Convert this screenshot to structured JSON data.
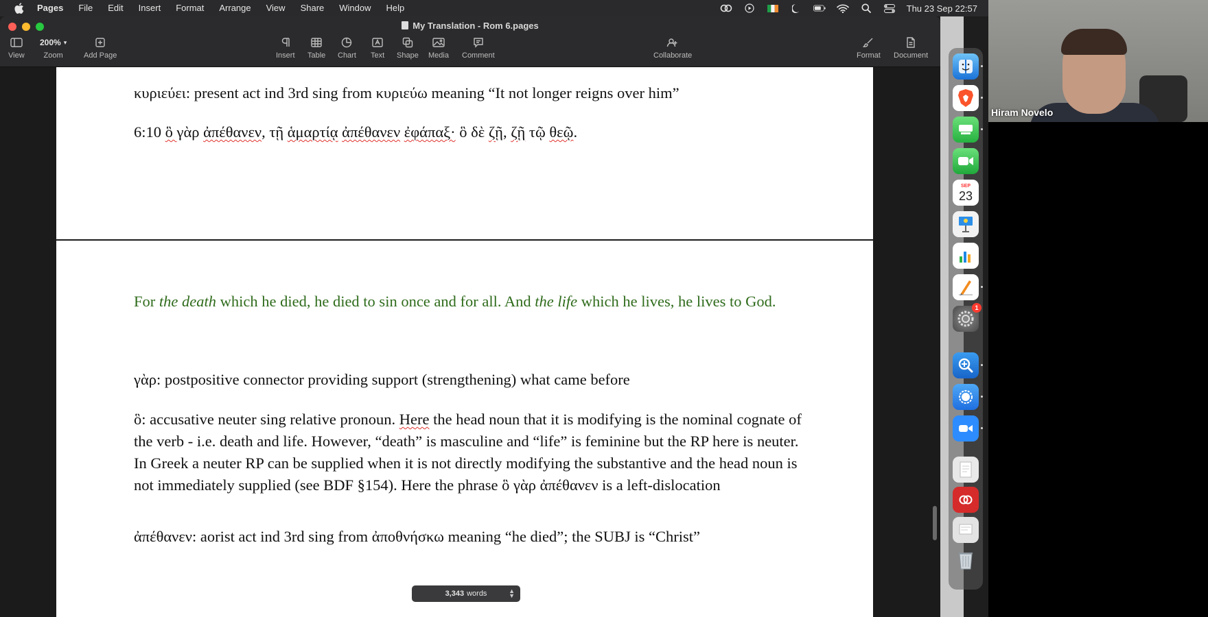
{
  "menubar": {
    "app": "Pages",
    "items": [
      "File",
      "Edit",
      "Insert",
      "Format",
      "Arrange",
      "View",
      "Share",
      "Window",
      "Help"
    ],
    "clock": "Thu 23 Sep  22:57",
    "status_icons": [
      "creative-cloud-icon",
      "play-icon",
      "flag-icon",
      "moon-icon",
      "battery-icon",
      "wifi-icon",
      "search-icon",
      "control-center-icon"
    ]
  },
  "window": {
    "title": "My Translation - Rom 6.pages",
    "toolbar": {
      "view": "View",
      "zoom_value": "200%",
      "zoom": "Zoom",
      "add_page": "Add Page",
      "insert": "Insert",
      "table": "Table",
      "chart": "Chart",
      "text": "Text",
      "shape": "Shape",
      "media": "Media",
      "comment": "Comment",
      "collaborate": "Collaborate",
      "format": "Format",
      "document": "Document"
    }
  },
  "document": {
    "line1": "κυριεύει: present act ind 3rd sing from κυριεύω meaning “It not longer reigns over him”",
    "verse_ref": "6:10 ",
    "verse_a": "ὃ ",
    "verse_b": "γὰρ ",
    "verse_c": "ἀπέθανεν",
    "verse_d": ", τῇ ",
    "verse_e": "ἁμαρτίᾳ",
    "verse_f": " ",
    "verse_g": "ἀπέθανεν",
    "verse_h": " ",
    "verse_i": "ἐφάπαξ·",
    "verse_j": " ὃ δὲ ",
    "verse_k": "ζῇ",
    "verse_l": ", ",
    "verse_m": "ζῇ",
    "verse_n": " τῷ ",
    "verse_o": "θεῷ",
    "verse_p": ".",
    "translation_1": "For ",
    "translation_2": "the death",
    "translation_3": " which he died, he died to sin once and for all.  And ",
    "translation_4": "the life",
    "translation_5": " which he lives, he lives to God.",
    "gar_note": "γὰρ: postpositive connector providing support (strengthening) what came before",
    "ho_note_1": "ὃ: accusative neuter sing relative pronoun.  ",
    "ho_note_2": "Here",
    "ho_note_3": " the head noun that it is modifying is the nominal cognate of the verb - i.e. death and life.  However, “death” is masculine and “life” is feminine but the RP here is neuter.  In Greek a neuter RP can be supplied when it is not directly modifying the substantive and the head noun is not immediately supplied (see BDF §154).  Here the phrase ὃ γὰρ ἀπέθανεν is a left-dislocation",
    "apethanen_note": "ἀπέθανεν: aorist act ind 3rd sing from ἀποθνήσκω meaning “he died”; the SUBJ is “Christ”"
  },
  "wordcount": {
    "number": "3,343",
    "label": "words"
  },
  "dock": {
    "calendar_month": "SEP",
    "calendar_day": "23",
    "settings_badge": "1"
  },
  "webcam": {
    "name": "Hiram Novelo"
  }
}
